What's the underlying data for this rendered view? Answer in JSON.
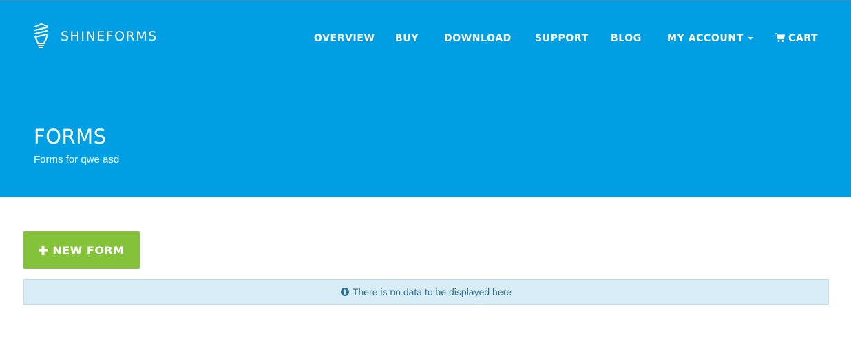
{
  "brand": {
    "name": "SHINEFORMS",
    "logo_icon": "lightbulb-icon",
    "header_color": "#009fe3"
  },
  "nav": {
    "items": [
      {
        "label": "OVERVIEW"
      },
      {
        "label": "BUY"
      },
      {
        "label": "DOWNLOAD"
      },
      {
        "label": "SUPPORT"
      },
      {
        "label": "BLOG"
      },
      {
        "label": "MY ACCOUNT",
        "icon": "caret-down-icon"
      },
      {
        "label": "CART",
        "icon": "shopping-cart-icon"
      }
    ]
  },
  "header": {
    "title": "FORMS",
    "subtitle": "Forms for qwe asd"
  },
  "actions": {
    "new_form_label": "NEW FORM",
    "new_form_icon": "plus-icon",
    "button_color": "#84c23a"
  },
  "alert": {
    "icon": "info-circle-icon",
    "message": "There is no data to be displayed here"
  }
}
